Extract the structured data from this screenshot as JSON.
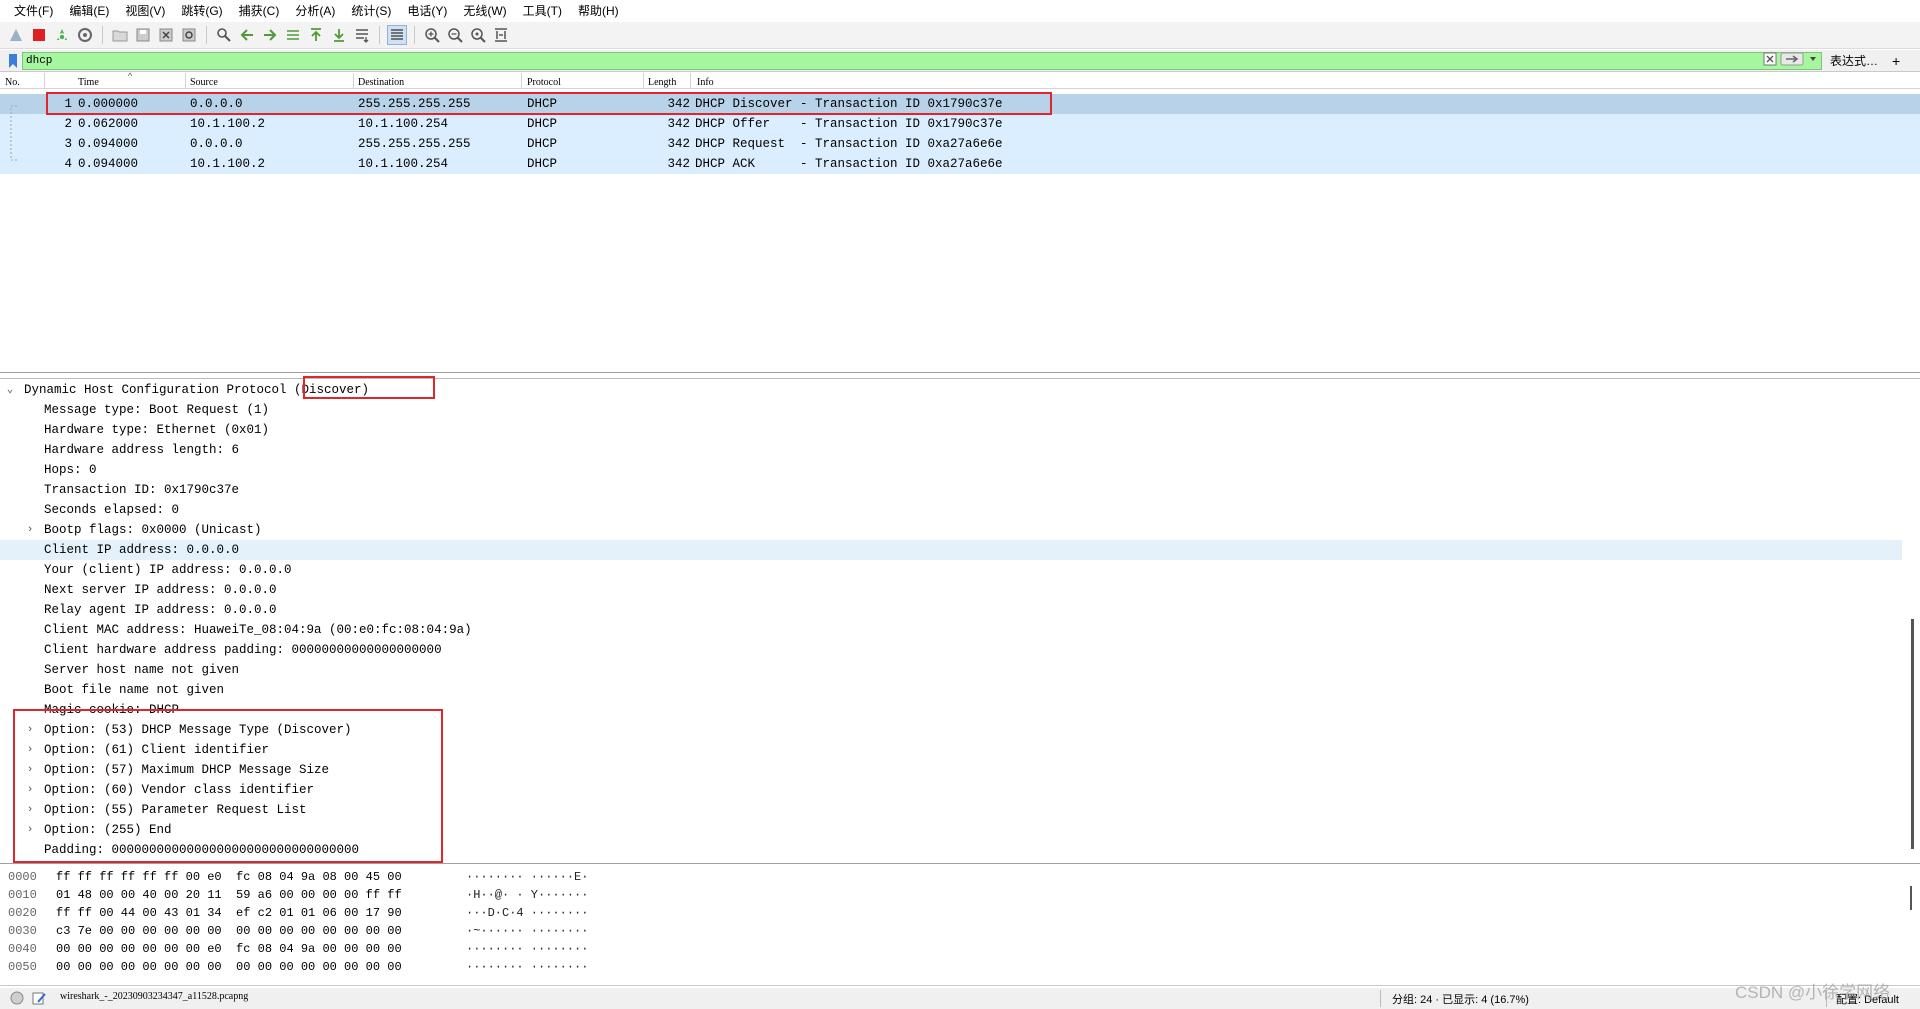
{
  "menu": [
    {
      "label": "文件(F)"
    },
    {
      "label": "编辑(E)"
    },
    {
      "label": "视图(V)"
    },
    {
      "label": "跳转(G)"
    },
    {
      "label": "捕获(C)"
    },
    {
      "label": "分析(A)"
    },
    {
      "label": "统计(S)"
    },
    {
      "label": "电话(Y)"
    },
    {
      "label": "无线(W)"
    },
    {
      "label": "工具(T)"
    },
    {
      "label": "帮助(H)"
    }
  ],
  "filter": {
    "value": "dhcp",
    "expression_label": "表达式…",
    "add_label": "+"
  },
  "packet_list": {
    "columns": [
      {
        "label": "No."
      },
      {
        "label": "Time"
      },
      {
        "label": "Source"
      },
      {
        "label": "Destination"
      },
      {
        "label": "Protocol"
      },
      {
        "label": "Length"
      },
      {
        "label": "Info"
      }
    ],
    "rows": [
      {
        "no": "1",
        "time": "0.000000",
        "source": "0.0.0.0",
        "destination": "255.255.255.255",
        "protocol": "DHCP",
        "length": "342",
        "info": "DHCP Discover - Transaction ID 0x1790c37e",
        "selected": true
      },
      {
        "no": "2",
        "time": "0.062000",
        "source": "10.1.100.2",
        "destination": "10.1.100.254",
        "protocol": "DHCP",
        "length": "342",
        "info": "DHCP Offer    - Transaction ID 0x1790c37e",
        "selected": false
      },
      {
        "no": "3",
        "time": "0.094000",
        "source": "0.0.0.0",
        "destination": "255.255.255.255",
        "protocol": "DHCP",
        "length": "342",
        "info": "DHCP Request  - Transaction ID 0xa27a6e6e",
        "selected": false
      },
      {
        "no": "4",
        "time": "0.094000",
        "source": "10.1.100.2",
        "destination": "10.1.100.254",
        "protocol": "DHCP",
        "length": "342",
        "info": "DHCP ACK      - Transaction ID 0xa27a6e6e",
        "selected": false
      }
    ]
  },
  "detail": {
    "items": [
      {
        "text": "Dynamic Host Configuration Protocol (Discover)",
        "arrow": "expanded",
        "level": 0
      },
      {
        "text": "Message type: Boot Request (1)",
        "arrow": "none",
        "level": 1
      },
      {
        "text": "Hardware type: Ethernet (0x01)",
        "arrow": "none",
        "level": 1
      },
      {
        "text": "Hardware address length: 6",
        "arrow": "none",
        "level": 1
      },
      {
        "text": "Hops: 0",
        "arrow": "none",
        "level": 1
      },
      {
        "text": "Transaction ID: 0x1790c37e",
        "arrow": "none",
        "level": 1
      },
      {
        "text": "Seconds elapsed: 0",
        "arrow": "none",
        "level": 1
      },
      {
        "text": "Bootp flags: 0x0000 (Unicast)",
        "arrow": "collapsed",
        "level": 1
      },
      {
        "text": "Client IP address: 0.0.0.0",
        "arrow": "none",
        "level": 1,
        "highlight": true
      },
      {
        "text": "Your (client) IP address: 0.0.0.0",
        "arrow": "none",
        "level": 1
      },
      {
        "text": "Next server IP address: 0.0.0.0",
        "arrow": "none",
        "level": 1
      },
      {
        "text": "Relay agent IP address: 0.0.0.0",
        "arrow": "none",
        "level": 1
      },
      {
        "text": "Client MAC address: HuaweiTe_08:04:9a (00:e0:fc:08:04:9a)",
        "arrow": "none",
        "level": 1
      },
      {
        "text": "Client hardware address padding: 00000000000000000000",
        "arrow": "none",
        "level": 1
      },
      {
        "text": "Server host name not given",
        "arrow": "none",
        "level": 1
      },
      {
        "text": "Boot file name not given",
        "arrow": "none",
        "level": 1
      },
      {
        "text": "Magic cookie: DHCP",
        "arrow": "none",
        "level": 1
      },
      {
        "text": "Option: (53) DHCP Message Type (Discover)",
        "arrow": "collapsed",
        "level": 1
      },
      {
        "text": "Option: (61) Client identifier",
        "arrow": "collapsed",
        "level": 1
      },
      {
        "text": "Option: (57) Maximum DHCP Message Size",
        "arrow": "collapsed",
        "level": 1
      },
      {
        "text": "Option: (60) Vendor class identifier",
        "arrow": "collapsed",
        "level": 1
      },
      {
        "text": "Option: (55) Parameter Request List",
        "arrow": "collapsed",
        "level": 1
      },
      {
        "text": "Option: (255) End",
        "arrow": "collapsed",
        "level": 1
      },
      {
        "text": "Padding: 000000000000000000000000000000000",
        "arrow": "none",
        "level": 1
      }
    ]
  },
  "hex": {
    "rows": [
      {
        "offset": "0000",
        "bytes": "ff ff ff ff ff ff 00 e0  fc 08 04 9a 08 00 45 00",
        "ascii": "········ ······E·"
      },
      {
        "offset": "0010",
        "bytes": "01 48 00 00 40 00 20 11  59 a6 00 00 00 00 ff ff",
        "ascii": "·H··@· · Y·······"
      },
      {
        "offset": "0020",
        "bytes": "ff ff 00 44 00 43 01 34  ef c2 01 01 06 00 17 90",
        "ascii": "···D·C·4 ········"
      },
      {
        "offset": "0030",
        "bytes": "c3 7e 00 00 00 00 00 00  00 00 00 00 00 00 00 00",
        "ascii": "·~······ ········"
      },
      {
        "offset": "0040",
        "bytes": "00 00 00 00 00 00 00 e0  fc 08 04 9a 00 00 00 00",
        "ascii": "········ ········"
      },
      {
        "offset": "0050",
        "bytes": "00 00 00 00 00 00 00 00  00 00 00 00 00 00 00 00",
        "ascii": "········ ········"
      }
    ]
  },
  "status": {
    "file": "wireshark_-_20230903234347_a11528.pcapng",
    "counts": "分组: 24 · 已显示: 4 (16.7%)",
    "profile": "配置: Default"
  },
  "watermark": "CSDN @小徐学网络",
  "colors": {
    "selected_row": "#b8d2ea",
    "row_bg": "#dbeeff",
    "filter_bg": "#a6f59f",
    "annotation": "#e0262b"
  }
}
